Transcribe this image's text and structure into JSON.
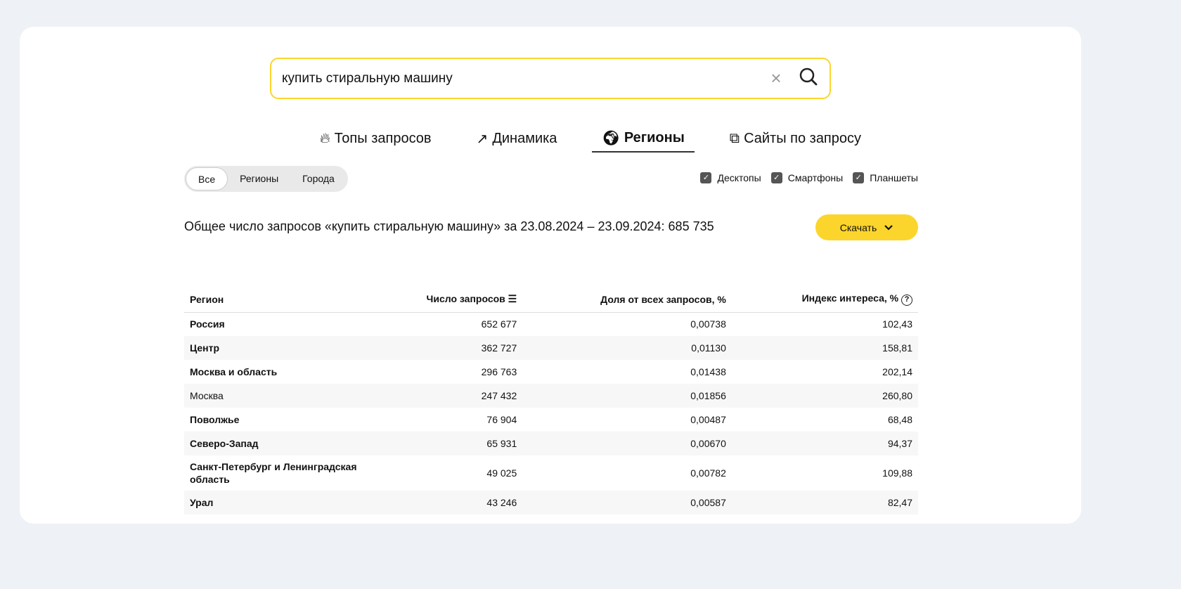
{
  "search": {
    "value": "купить стиральную машину"
  },
  "tabs": [
    {
      "label": "Топы запросов",
      "icon": "fire-icon"
    },
    {
      "label": "Динамика",
      "icon": "trend-icon"
    },
    {
      "label": "Регионы",
      "icon": "globe-icon",
      "active": true
    },
    {
      "label": "Сайты по запросу",
      "icon": "external-link-icon"
    }
  ],
  "segments": [
    "Все",
    "Регионы",
    "Города"
  ],
  "devices": [
    "Десктопы",
    "Смартфоны",
    "Планшеты"
  ],
  "summary": "Общее число запросов «купить стиральную машину» за 23.08.2024 – 23.09.2024: 685 735",
  "download": "Скачать",
  "table": {
    "headers": [
      "Регион",
      "Число запросов",
      "Доля от всех запросов, %",
      "Индекс интереса, %"
    ],
    "rows": [
      [
        "Россия",
        "652 677",
        "0,00738",
        "102,43"
      ],
      [
        "Центр",
        "362 727",
        "0,01130",
        "158,81"
      ],
      [
        "Москва и область",
        "296 763",
        "0,01438",
        "202,14"
      ],
      [
        "Москва",
        "247 432",
        "0,01856",
        "260,80"
      ],
      [
        "Поволжье",
        "76 904",
        "0,00487",
        "68,48"
      ],
      [
        "Северо-Запад",
        "65 931",
        "0,00670",
        "94,37"
      ],
      [
        "Санкт-Петербург и Ленинградская область",
        "49 025",
        "0,00782",
        "109,88"
      ],
      [
        "Урал",
        "43 246",
        "0,00587",
        "82,47"
      ]
    ]
  }
}
